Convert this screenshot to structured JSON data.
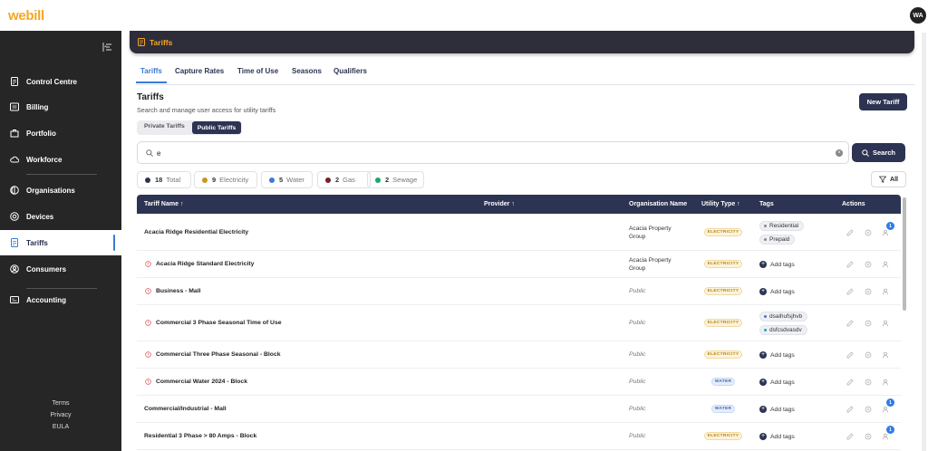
{
  "brand": {
    "logo_first": "w",
    "logo_rest": "ebill",
    "color": "#f5a623"
  },
  "user": {
    "initials": "WA"
  },
  "sidebar": {
    "items": [
      {
        "label": "Control Centre",
        "icon": "document-icon"
      },
      {
        "label": "Billing",
        "icon": "billing-icon"
      },
      {
        "label": "Portfolio",
        "icon": "portfolio-icon"
      },
      {
        "label": "Workforce",
        "icon": "cloud-icon"
      },
      {
        "label": "Organisations",
        "icon": "globe-icon"
      },
      {
        "label": "Devices",
        "icon": "target-icon"
      },
      {
        "label": "Tariffs",
        "icon": "tariff-icon",
        "active": true
      },
      {
        "label": "Consumers",
        "icon": "user-circle-icon"
      },
      {
        "label": "Accounting",
        "icon": "accounting-icon"
      }
    ],
    "footer": [
      "Terms",
      "Privacy",
      "EULA"
    ]
  },
  "header": {
    "title": "Tariffs"
  },
  "tabs": [
    "Tariffs",
    "Capture Rates",
    "Time of Use",
    "Seasons",
    "Qualifiers"
  ],
  "page": {
    "title": "Tariffs",
    "subtitle": "Search and manage user access for utility tariffs",
    "new_button": "New Tariff",
    "segment": {
      "options": [
        "Private Tariffs",
        "Public Tariffs"
      ],
      "selected": "Public Tariffs"
    }
  },
  "search": {
    "value": "e",
    "button": "Search"
  },
  "filters": [
    {
      "count": "18",
      "label": "Total",
      "color": "#2d3352"
    },
    {
      "count": "9",
      "label": "Electricity",
      "color": "#c8961e"
    },
    {
      "count": "5",
      "label": "Water",
      "color": "#3a7bd5"
    },
    {
      "count": "2",
      "label": "Gas",
      "color": "#7a1f1f"
    },
    {
      "count": "2",
      "label": "Sewage",
      "color": "#1aa86b"
    }
  ],
  "filter_all": "All",
  "table": {
    "headers": {
      "name": "Tariff Name",
      "provider": "Provider",
      "org": "Organisation Name",
      "utility": "Utility Type",
      "tags": "Tags",
      "actions": "Actions"
    },
    "sort_arrow": "↑",
    "rows": [
      {
        "name": "Acacia Ridge Residential Electricity",
        "warn": false,
        "org": [
          "Acacia Property",
          "Group"
        ],
        "public": false,
        "utility": "ELECTRICITY",
        "tags": [
          {
            "t": "Residential",
            "c": "#888"
          },
          {
            "t": "Prepaid",
            "c": "#888"
          }
        ],
        "notif": "1"
      },
      {
        "name": "Acacia Ridge Standard Electricity",
        "warn": true,
        "org": [
          "Acacia Property",
          "Group"
        ],
        "public": false,
        "utility": "ELECTRICITY",
        "tags": [],
        "notif": ""
      },
      {
        "name": "Business - Mall",
        "warn": true,
        "org": [
          "Public"
        ],
        "public": true,
        "utility": "ELECTRICITY",
        "tags": [],
        "notif": ""
      },
      {
        "name": "Commercial 3 Phase Seasonal Time of Use",
        "warn": true,
        "org": [
          "Public"
        ],
        "public": true,
        "utility": "ELECTRICITY",
        "tags": [
          {
            "t": "dsaihufsjhvb",
            "c": "#5a6bd5"
          },
          {
            "t": "dsfcsdvasdv",
            "c": "#1aa8b8"
          }
        ],
        "notif": ""
      },
      {
        "name": "Commercial Three Phase Seasonal - Block",
        "warn": true,
        "org": [
          "Public"
        ],
        "public": true,
        "utility": "ELECTRICITY",
        "tags": [],
        "notif": ""
      },
      {
        "name": "Commercial Water 2024 - Block",
        "warn": true,
        "org": [
          "Public"
        ],
        "public": true,
        "utility": "WATER",
        "tags": [],
        "notif": ""
      },
      {
        "name": "Commercial/Industrial - Mall",
        "warn": false,
        "org": [
          "Public"
        ],
        "public": true,
        "utility": "WATER",
        "tags": [],
        "notif": "1"
      },
      {
        "name": "Residential 3 Phase > 80 Amps - Block",
        "warn": false,
        "org": [
          "Public"
        ],
        "public": true,
        "utility": "ELECTRICITY",
        "tags": [],
        "notif": "1"
      }
    ],
    "add_tags": "Add tags"
  }
}
